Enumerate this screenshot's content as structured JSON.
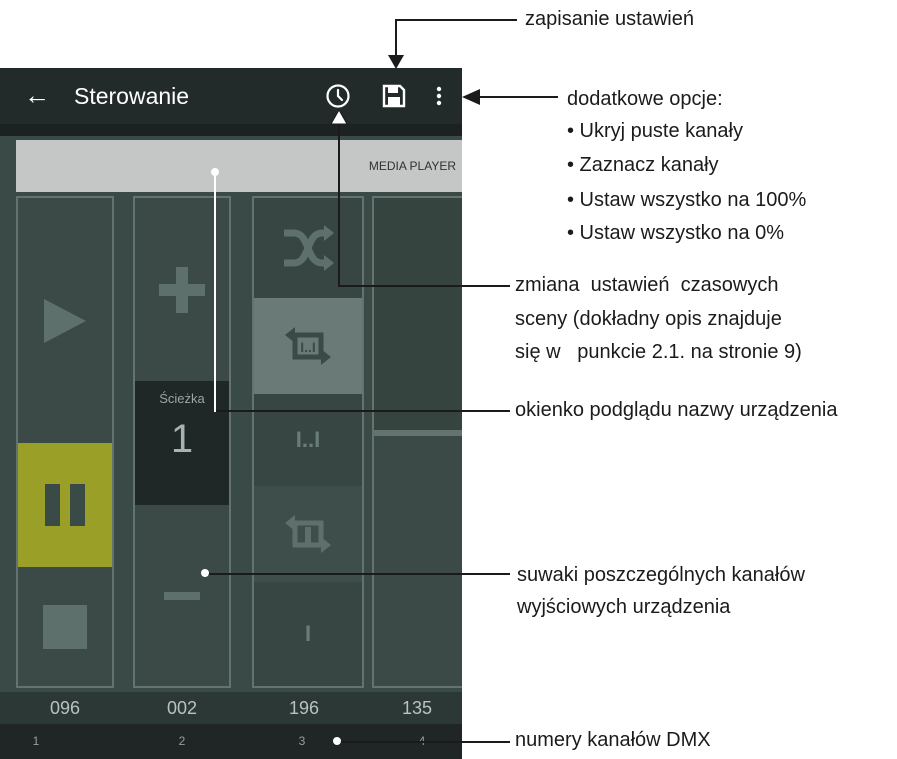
{
  "appbar": {
    "title": "Sterowanie"
  },
  "preview": {
    "label": "MEDIA PLAYER"
  },
  "channels": [
    {
      "value": "096",
      "number": "1"
    },
    {
      "value": "002",
      "number": "2"
    },
    {
      "value": "196",
      "number": "3"
    },
    {
      "value": "135",
      "number": "4"
    }
  ],
  "channel2": {
    "label": "Ścieżka",
    "value": "1"
  },
  "channel3_labels": {
    "pause_sym": "I..I",
    "single_sym": "I"
  },
  "annotations": {
    "save": "zapisanie ustawień",
    "options_title": "dodatkowe opcje:",
    "options": [
      "• Ukryj puste kanały",
      "• Zaznacz kanały",
      "• Ustaw wszystko na 100%",
      "• Ustaw wszystko na 0%"
    ],
    "timing": [
      "zmiana  ustawień  czasowych",
      "sceny (dokładny opis znajduje",
      "się w   punkcie 2.1. na stronie 9)"
    ],
    "preview": "okienko podglądu nazwy urządzenia",
    "sliders": [
      "suwaki poszczególnych kanałów",
      "wyjściowych urządzenia"
    ],
    "dmx": "numery kanałów DMX"
  },
  "colors": {
    "appbar": "#232b2a",
    "panel": "#3b4a47",
    "highlight": "#9a9f27",
    "preview": "#c4c7c6"
  }
}
